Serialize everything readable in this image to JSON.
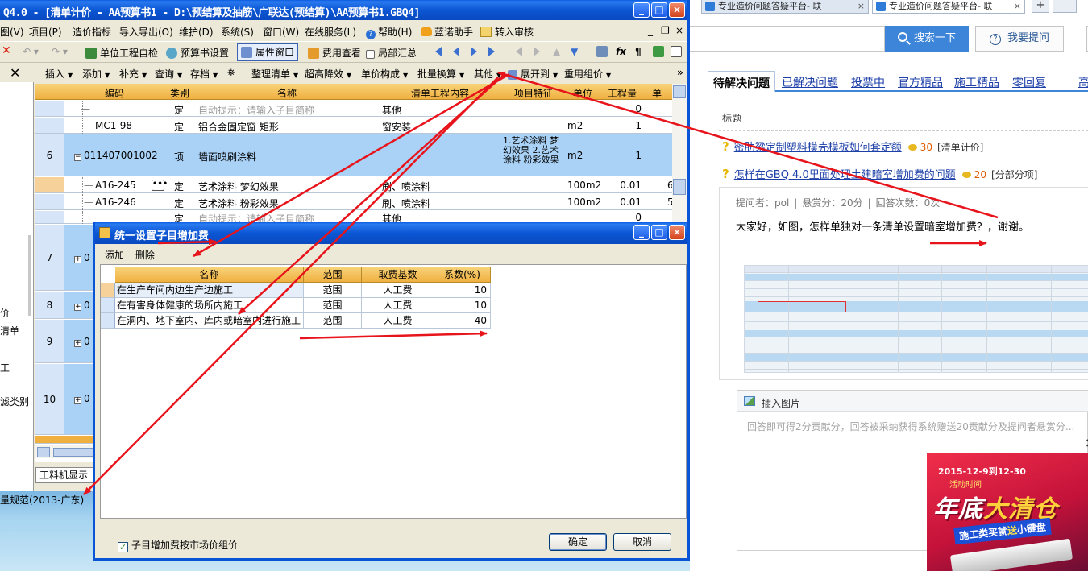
{
  "main_window": {
    "title": "Q4.0 - [清单计价 - AA预算书1 - D:\\预结算及抽筋\\广联达(预结算)\\AA预算书1.GBQ4]",
    "menu": [
      "图(V)",
      "项目(P)",
      "造价指标",
      "导入导出(O)",
      "维护(D)",
      "系统(S)",
      "窗口(W)",
      "在线服务(L)",
      "帮助(H)",
      "蓝诺助手",
      "转入审核"
    ],
    "toolbar1": {
      "unit_check": "单位工程自检",
      "budget_settings": "预算书设置",
      "property_window": "属性窗口",
      "fee_view": "费用查看",
      "partial_summary": "局部汇总"
    },
    "toolbar2": [
      "插入",
      "添加",
      "补充",
      "查询",
      "存档",
      "整理清单",
      "超高降效",
      "单价构成",
      "批量换算",
      "其他",
      "展开到",
      "重用组价"
    ],
    "left_pane": [
      "价",
      "清单",
      "工",
      "滤类别"
    ],
    "grid": {
      "headers": [
        "编码",
        "类别",
        "名称",
        "清单工程内容",
        "项目特征",
        "单位",
        "工程量",
        "单"
      ],
      "rows": [
        {
          "no": "",
          "code": "",
          "type": "定",
          "name": "自动提示：请输入子目简称",
          "content": "其他",
          "feature": "",
          "unit": "",
          "qty": "0",
          "extra": ""
        },
        {
          "no": "",
          "code": "MC1-98",
          "type": "定",
          "name": "铝合金固定窗 矩形",
          "content": "窗安装",
          "feature": "",
          "unit": "m2",
          "qty": "1",
          "extra": ""
        },
        {
          "no": "6",
          "code": "011407001002",
          "type": "项",
          "name": "墙面喷刷涂料",
          "content": "",
          "feature": "1.艺术涂料 梦幻效果 2.艺术涂料 粉彩效果",
          "unit": "m2",
          "qty": "1",
          "extra": ""
        },
        {
          "no": "",
          "code": "A16-245",
          "type": "定",
          "name": "艺术涂料 梦幻效果",
          "content": "刷、喷涂料",
          "feature": "",
          "unit": "100m2",
          "qty": "0.01",
          "extra": "6"
        },
        {
          "no": "",
          "code": "A16-246",
          "type": "定",
          "name": "艺术涂料 粉彩效果",
          "content": "刷、喷涂料",
          "feature": "",
          "unit": "100m2",
          "qty": "0.01",
          "extra": "5"
        },
        {
          "no": "",
          "code": "",
          "type": "定",
          "name": "自动提示：请输入子目简称",
          "content": "其他",
          "feature": "",
          "unit": "",
          "qty": "0",
          "extra": ""
        }
      ],
      "lower_rows": [
        {
          "no": "7",
          "code": "0"
        },
        {
          "no": "8",
          "code": "0"
        },
        {
          "no": "9",
          "code": "0"
        },
        {
          "no": "10",
          "code": "0"
        }
      ]
    },
    "bottom_tab": "工料机显示",
    "status": "量规范(2013-广东)"
  },
  "dialog": {
    "title": "统一设置子目增加费",
    "toolbar": [
      "添加",
      "删除"
    ],
    "headers": [
      "名称",
      "范围",
      "取费基数",
      "系数(%)"
    ],
    "rows": [
      {
        "name": "在生产车间内边生产边施工",
        "range": "范围",
        "base": "人工费",
        "coef": "10"
      },
      {
        "name": "在有害身体健康的场所内施工",
        "range": "范围",
        "base": "人工费",
        "coef": "10"
      },
      {
        "name": "在洞内、地下室内、库内或暗室内进行施工",
        "range": "范围",
        "base": "人工费",
        "coef": "40"
      }
    ],
    "checkbox_label": "子目增加费按市场价组价",
    "ok_label": "确定",
    "cancel_label": "取消"
  },
  "browser": {
    "tab1": "专业造价问题答疑平台- 联",
    "tab2": "专业造价问题答疑平台- 联",
    "search_button": "搜索一下",
    "ask_button": "我要提问",
    "tabs": [
      "待解决问题",
      "已解决问题",
      "投票中",
      "官方精品",
      "施工精品",
      "零回复",
      "高"
    ],
    "column_title": "标题",
    "questions": [
      {
        "title": "密肋梁定制塑料模壳模板如何套定额",
        "score": "30",
        "category": "[清单计价]"
      },
      {
        "title": "怎样在GBQ 4.0里面处理土建暗室增加费的问题",
        "score": "20",
        "category": "[分部分项]"
      }
    ],
    "meta": {
      "asker": "提问者：pol",
      "reward": "悬赏分：20分",
      "answers": "回答次数：0次"
    },
    "question_body": "大家好，如图，怎样单独对一条清单设置暗室增加费？，谢谢。",
    "insert_picture": "插入图片",
    "answer_placeholder": "回答即可得2分贡献分，回答被采纳获得系统赠送20贡献分及提问者悬赏分...",
    "ad": {
      "date": "2015-12-9到12-30",
      "sub": "活动时间",
      "title_a": "年底",
      "title_b": "大清仓",
      "tag_a": "施工类买就",
      "tag_b": "送",
      "tag_c": "小键盘"
    }
  },
  "colors": {
    "xp_blue": "#0a54d6",
    "header_orange": "#f0b040",
    "row_blue": "#a9d2f6",
    "arrow_red": "#e8141c",
    "link_blue": "#1d40a8"
  }
}
